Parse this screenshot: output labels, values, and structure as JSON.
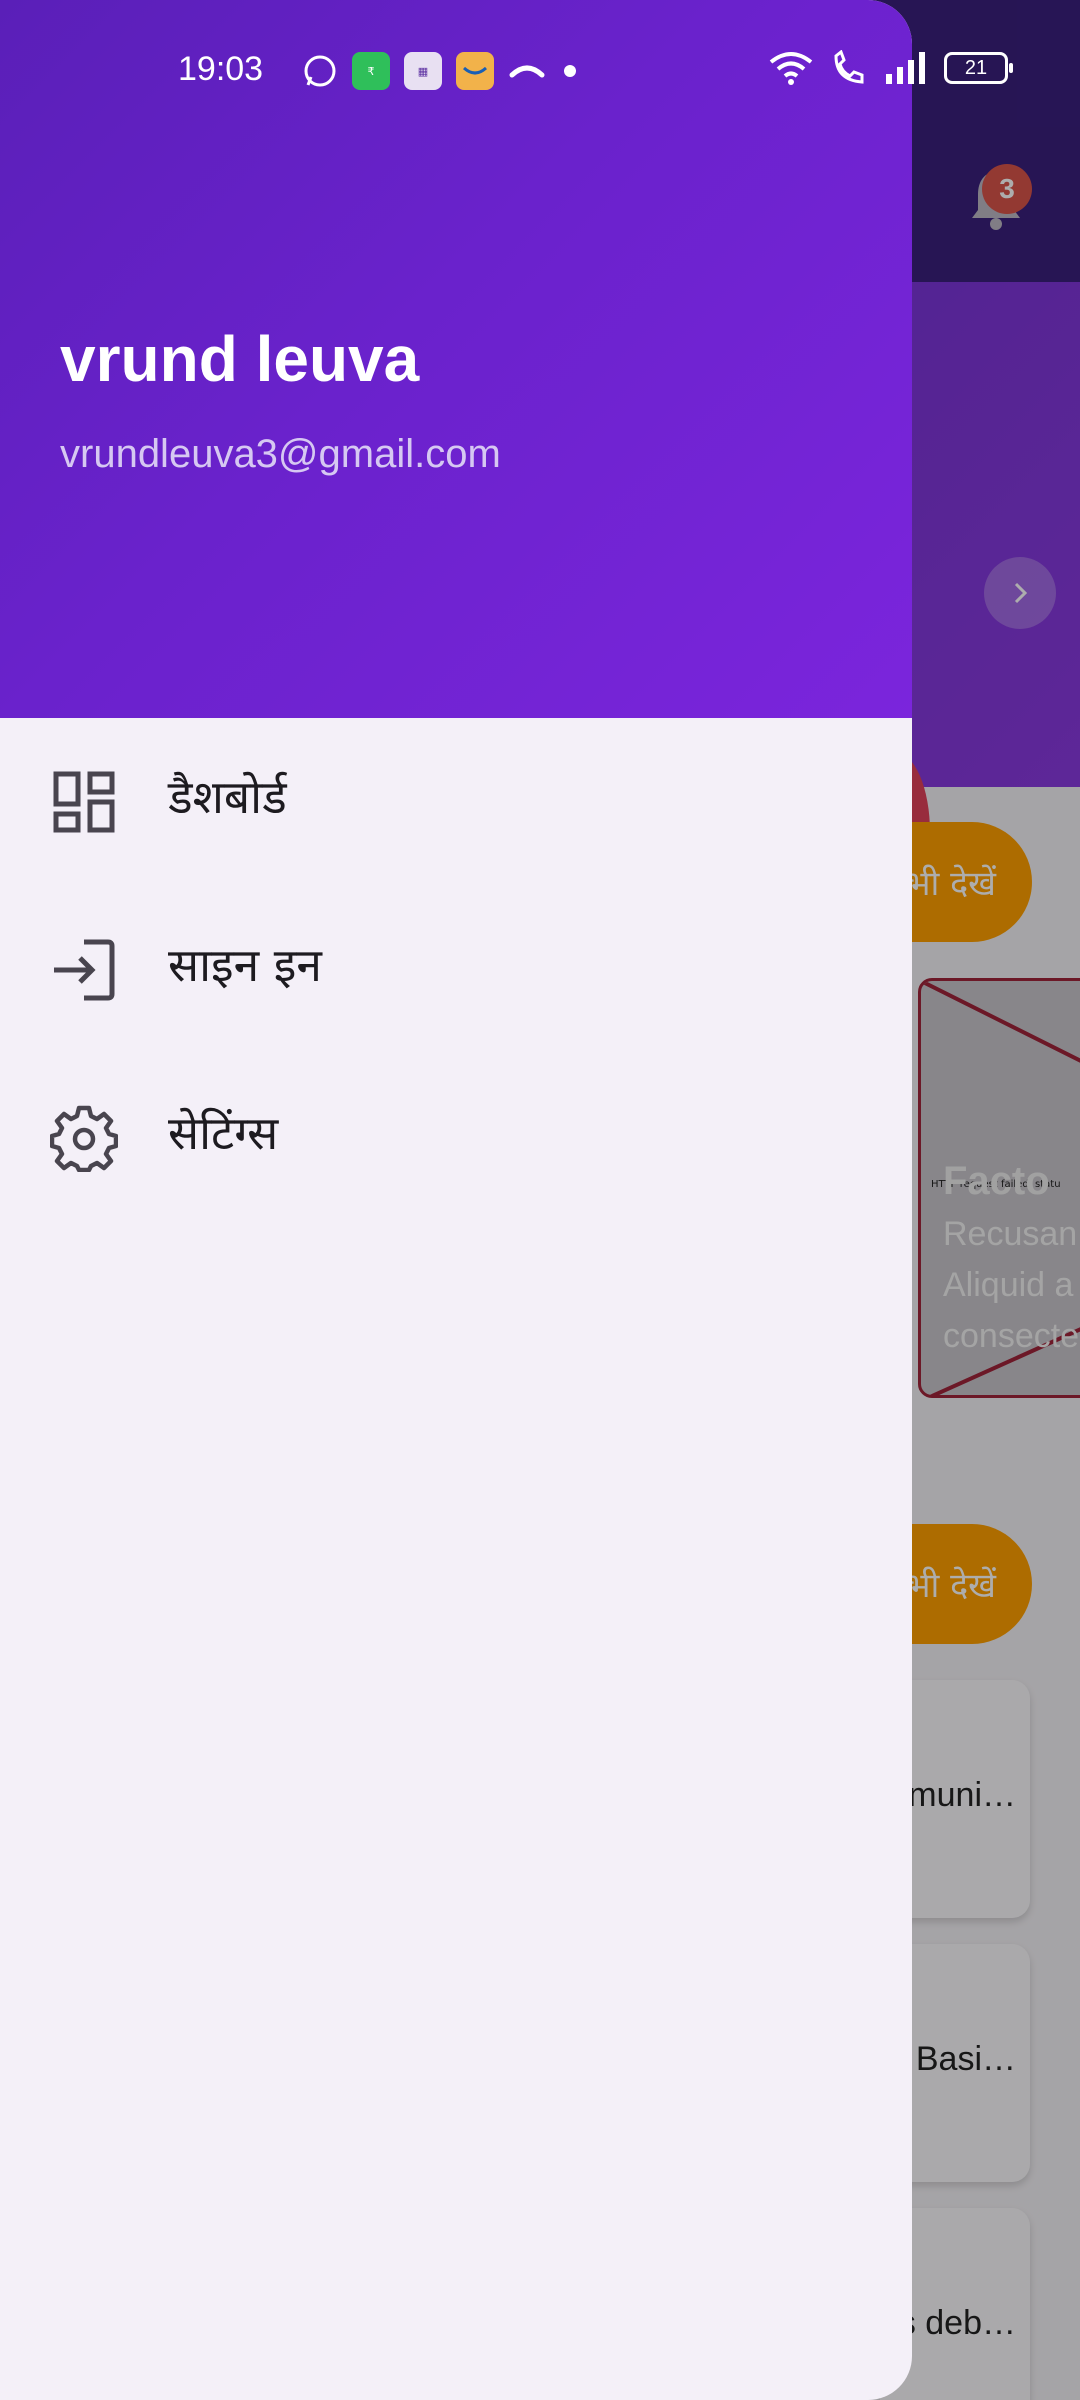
{
  "status_bar": {
    "time": "19:03",
    "left_icons": [
      "whatsapp-icon",
      "app-green-icon",
      "app-purple-icon",
      "amazon-icon",
      "missed-call-icon",
      "dot-icon"
    ],
    "right_icons": [
      "wifi-icon",
      "wifi-call-icon",
      "signal-icon",
      "battery-icon"
    ],
    "battery_level": "21"
  },
  "background_app": {
    "notification_count": "3",
    "see_all_label": "सभी देखें",
    "news_card": {
      "title": "Facto",
      "text": "Recusan\nAliquid a\nconsecte",
      "image_caption": "HTTP request failed, statu"
    },
    "list_cards": [
      "Communi…",
      "Basi…",
      "ous deb…"
    ],
    "colors": {
      "accent": "#ffa000",
      "topbar": "#3a1f7d"
    }
  },
  "drawer": {
    "user": {
      "name": "vrund leuva",
      "email": "vrundleuva3@gmail.com"
    },
    "items": [
      {
        "label": "डैशबोर्ड",
        "icon": "dashboard-icon"
      },
      {
        "label": "साइन इन",
        "icon": "login-icon"
      },
      {
        "label": "सेटिंग्स",
        "icon": "gear-icon"
      }
    ],
    "colors": {
      "header_start": "#5a1fb8",
      "header_end": "#7b25dc",
      "body": "#f4f0f8"
    }
  }
}
